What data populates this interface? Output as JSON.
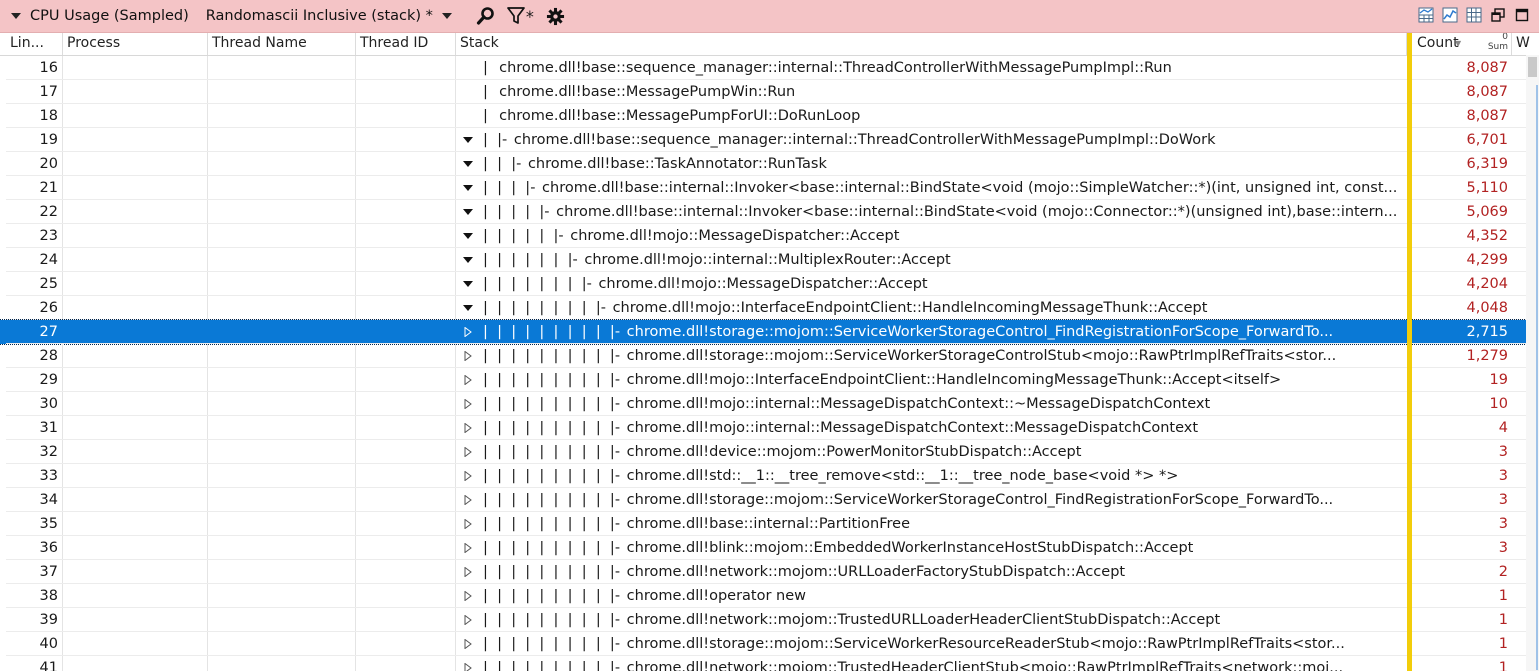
{
  "window": {
    "title": "CPU Usage (Sampled)",
    "preset": "Randomascii Inclusive (stack) *",
    "filter_label": "*"
  },
  "columns": {
    "line": "Lin...",
    "process": "Process",
    "thread_name": "Thread Name",
    "thread_id": "Thread ID",
    "stack": "Stack",
    "count": "Count",
    "count_agg": "Sum",
    "count_sort": "0",
    "weight": "W"
  },
  "colors": {
    "titlebar": "#f4c4c6",
    "selection": "#0a79d6",
    "count_text": "#b22222",
    "divider": "#f2cd0a"
  },
  "rows": [
    {
      "line": "16",
      "expand": "none",
      "prefix": "|  ",
      "frame": "chrome.dll!base::sequence_manager::internal::ThreadControllerWithMessagePumpImpl::Run",
      "count": "8,087",
      "depth": 0
    },
    {
      "line": "17",
      "expand": "none",
      "prefix": "|  ",
      "frame": "chrome.dll!base::MessagePumpWin::Run",
      "count": "8,087",
      "depth": 0
    },
    {
      "line": "18",
      "expand": "none",
      "prefix": "|  ",
      "frame": "chrome.dll!base::MessagePumpForUI::DoRunLoop",
      "count": "8,087",
      "depth": 0
    },
    {
      "line": "19",
      "expand": "open",
      "prefix": "|  |- ",
      "frame": "chrome.dll!base::sequence_manager::internal::ThreadControllerWithMessagePumpImpl::DoWork",
      "count": "6,701",
      "depth": 0
    },
    {
      "line": "20",
      "expand": "open",
      "prefix": "|  |  |- ",
      "frame": "chrome.dll!base::TaskAnnotator::RunTask",
      "count": "6,319",
      "depth": 0
    },
    {
      "line": "21",
      "expand": "open",
      "prefix": "|  |  |  |- ",
      "frame": "chrome.dll!base::internal::Invoker<base::internal::BindState<void (mojo::SimpleWatcher::*)(int, unsigned int, const...",
      "count": "5,110",
      "depth": 0
    },
    {
      "line": "22",
      "expand": "open",
      "prefix": "|  |  |  |  |- ",
      "frame": "chrome.dll!base::internal::Invoker<base::internal::BindState<void (mojo::Connector::*)(unsigned int),base::intern...",
      "count": "5,069",
      "depth": 0
    },
    {
      "line": "23",
      "expand": "open",
      "prefix": "|  |  |  |  |  |- ",
      "frame": "chrome.dll!mojo::MessageDispatcher::Accept",
      "count": "4,352",
      "depth": 0
    },
    {
      "line": "24",
      "expand": "open",
      "prefix": "|  |  |  |  |  |  |- ",
      "frame": "chrome.dll!mojo::internal::MultiplexRouter::Accept",
      "count": "4,299",
      "depth": 0
    },
    {
      "line": "25",
      "expand": "open",
      "prefix": "|  |  |  |  |  |  |  |- ",
      "frame": "chrome.dll!mojo::MessageDispatcher::Accept",
      "count": "4,204",
      "depth": 0
    },
    {
      "line": "26",
      "expand": "open",
      "prefix": "|  |  |  |  |  |  |  |  |- ",
      "frame": "chrome.dll!mojo::InterfaceEndpointClient::HandleIncomingMessageThunk::Accept",
      "count": "4,048",
      "depth": 0
    },
    {
      "line": "27",
      "expand": "closed",
      "prefix": "|  |  |  |  |  |  |  |  |  |- ",
      "frame": "chrome.dll!storage::mojom::ServiceWorkerStorageControl_FindRegistrationForScope_ForwardTo...",
      "count": "2,715",
      "depth": 0,
      "selected": true
    },
    {
      "line": "28",
      "expand": "closed",
      "prefix": "|  |  |  |  |  |  |  |  |  |- ",
      "frame": "chrome.dll!storage::mojom::ServiceWorkerStorageControlStub<mojo::RawPtrImplRefTraits<stor...",
      "count": "1,279",
      "depth": 0
    },
    {
      "line": "29",
      "expand": "closed",
      "prefix": "|  |  |  |  |  |  |  |  |  |- ",
      "frame": "chrome.dll!mojo::InterfaceEndpointClient::HandleIncomingMessageThunk::Accept<itself>",
      "count": "19",
      "depth": 0
    },
    {
      "line": "30",
      "expand": "closed",
      "prefix": "|  |  |  |  |  |  |  |  |  |- ",
      "frame": "chrome.dll!mojo::internal::MessageDispatchContext::~MessageDispatchContext",
      "count": "10",
      "depth": 0
    },
    {
      "line": "31",
      "expand": "closed",
      "prefix": "|  |  |  |  |  |  |  |  |  |- ",
      "frame": "chrome.dll!mojo::internal::MessageDispatchContext::MessageDispatchContext",
      "count": "4",
      "depth": 0
    },
    {
      "line": "32",
      "expand": "closed",
      "prefix": "|  |  |  |  |  |  |  |  |  |- ",
      "frame": "chrome.dll!device::mojom::PowerMonitorStubDispatch::Accept",
      "count": "3",
      "depth": 0
    },
    {
      "line": "33",
      "expand": "closed",
      "prefix": "|  |  |  |  |  |  |  |  |  |- ",
      "frame": "chrome.dll!std::__1::__tree_remove<std::__1::__tree_node_base<void *> *>",
      "count": "3",
      "depth": 0
    },
    {
      "line": "34",
      "expand": "closed",
      "prefix": "|  |  |  |  |  |  |  |  |  |- ",
      "frame": "chrome.dll!storage::mojom::ServiceWorkerStorageControl_FindRegistrationForScope_ForwardTo...",
      "count": "3",
      "depth": 0
    },
    {
      "line": "35",
      "expand": "closed",
      "prefix": "|  |  |  |  |  |  |  |  |  |- ",
      "frame": "chrome.dll!base::internal::PartitionFree",
      "count": "3",
      "depth": 0
    },
    {
      "line": "36",
      "expand": "closed",
      "prefix": "|  |  |  |  |  |  |  |  |  |- ",
      "frame": "chrome.dll!blink::mojom::EmbeddedWorkerInstanceHostStubDispatch::Accept",
      "count": "3",
      "depth": 0
    },
    {
      "line": "37",
      "expand": "closed",
      "prefix": "|  |  |  |  |  |  |  |  |  |- ",
      "frame": "chrome.dll!network::mojom::URLLoaderFactoryStubDispatch::Accept",
      "count": "2",
      "depth": 0
    },
    {
      "line": "38",
      "expand": "closed",
      "prefix": "|  |  |  |  |  |  |  |  |  |- ",
      "frame": "chrome.dll!operator new",
      "count": "1",
      "depth": 0
    },
    {
      "line": "39",
      "expand": "closed",
      "prefix": "|  |  |  |  |  |  |  |  |  |- ",
      "frame": "chrome.dll!network::mojom::TrustedURLLoaderHeaderClientStubDispatch::Accept",
      "count": "1",
      "depth": 0
    },
    {
      "line": "40",
      "expand": "closed",
      "prefix": "|  |  |  |  |  |  |  |  |  |- ",
      "frame": "chrome.dll!storage::mojom::ServiceWorkerResourceReaderStub<mojo::RawPtrImplRefTraits<stor...",
      "count": "1",
      "depth": 0
    },
    {
      "line": "41",
      "expand": "closed",
      "prefix": "|  |  |  |  |  |  |  |  |  |- ",
      "frame": "chrome.dll!network::mojom::TrustedHeaderClientStub<mojo::RawPtrImplRefTraits<network::moj...",
      "count": "1",
      "depth": 0
    }
  ]
}
